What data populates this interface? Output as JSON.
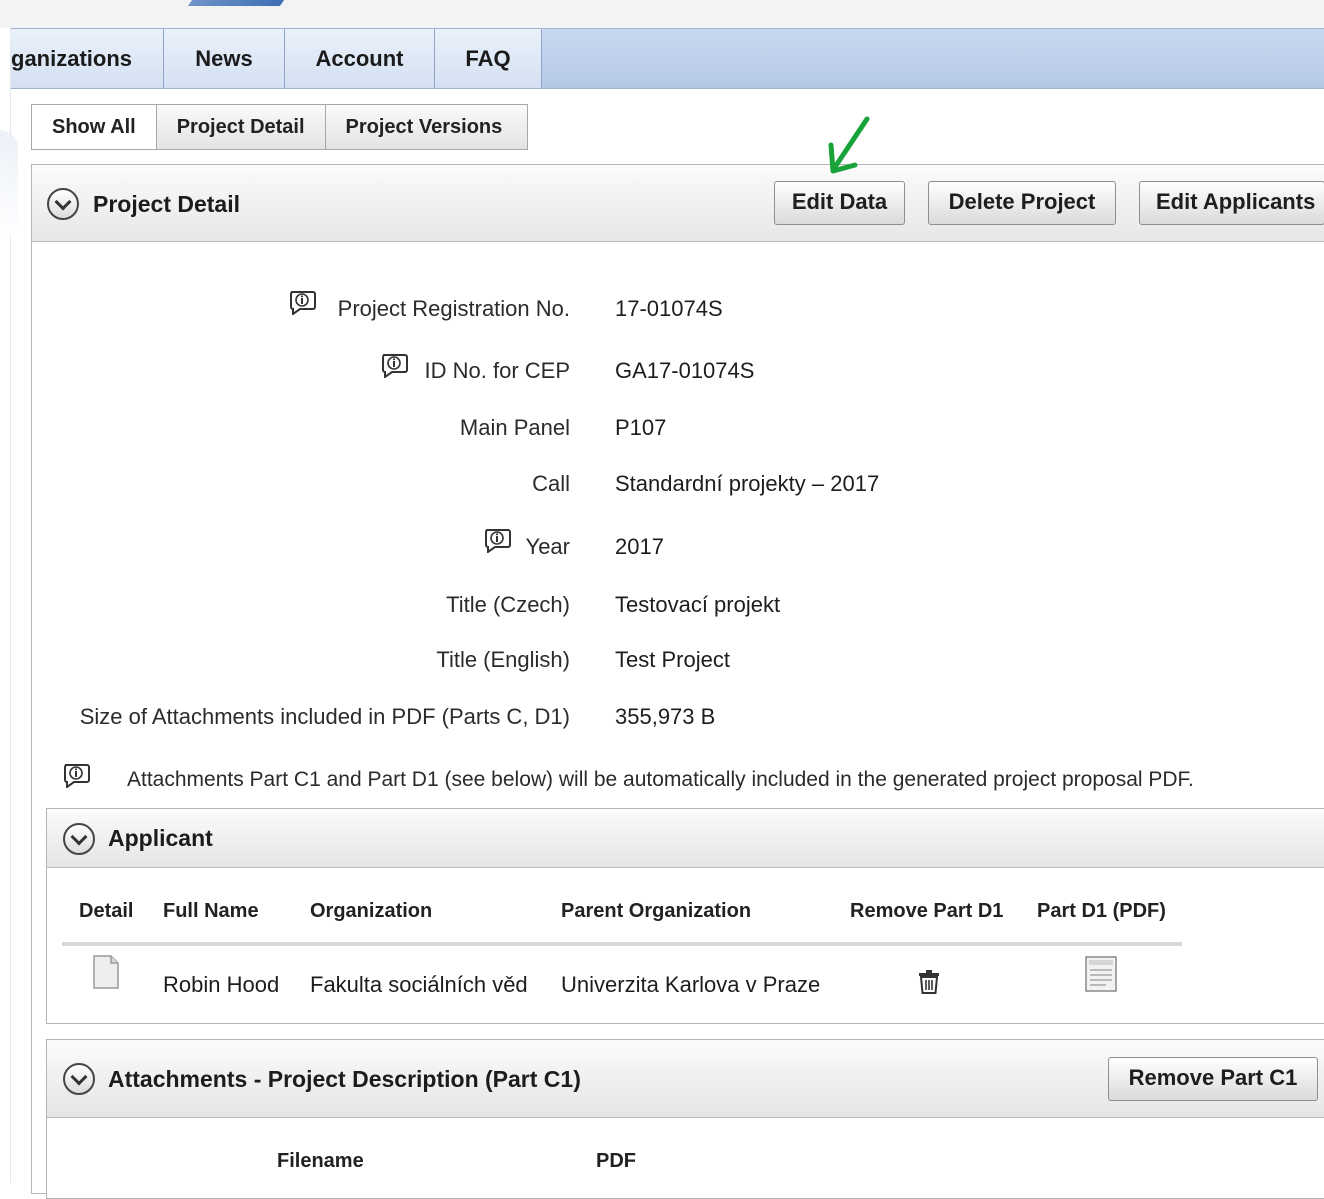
{
  "nav": {
    "items": [
      {
        "label": "ganizations"
      },
      {
        "label": "News"
      },
      {
        "label": "Account"
      },
      {
        "label": "FAQ"
      }
    ]
  },
  "subtabs": [
    {
      "label": "Show All"
    },
    {
      "label": "Project Detail"
    },
    {
      "label": "Project Versions"
    }
  ],
  "project_panel": {
    "title": "Project Detail",
    "buttons": {
      "edit": "Edit Data",
      "delete": "Delete Project",
      "applicants": "Edit Applicants"
    }
  },
  "fields": [
    {
      "label": "Project Registration No.",
      "value": "17-01074S",
      "info": true
    },
    {
      "label": "ID No. for CEP",
      "value": "GA17-01074S",
      "info": true
    },
    {
      "label": "Main Panel",
      "value": "P107",
      "info": false
    },
    {
      "label": "Call",
      "value": "Standardní projekty – 2017",
      "info": false
    },
    {
      "label": "Year",
      "value": "2017",
      "info": true
    },
    {
      "label": "Title (Czech)",
      "value": "Testovací projekt",
      "info": false
    },
    {
      "label": "Title (English)",
      "value": "Test Project",
      "info": false
    },
    {
      "label": "Size of Attachments included in PDF (Parts C, D1)",
      "value": "355,973 B",
      "info": false
    }
  ],
  "note": "Attachments Part C1 and Part D1 (see below) will be automatically included in the generated project proposal PDF.",
  "applicant": {
    "title": "Applicant",
    "columns": [
      "Detail",
      "Full Name",
      "Organization",
      "Parent Organization",
      "Remove Part D1",
      "Part D1 (PDF)"
    ],
    "row": {
      "full_name": "Robin Hood",
      "organization": "Fakulta sociálních věd",
      "parent": "Univerzita Karlova v Praze"
    }
  },
  "attachments": {
    "title": "Attachments - Project Description (Part C1)",
    "remove_button": "Remove Part C1",
    "columns": [
      "Filename",
      "PDF"
    ]
  },
  "colors": {
    "nav_bg": "#b4c8e6",
    "annotation_arrow": "#1aa33a"
  }
}
